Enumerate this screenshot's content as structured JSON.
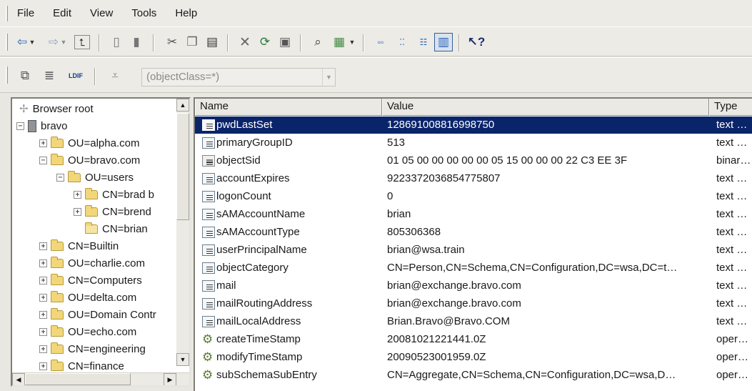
{
  "menu": [
    "File",
    "Edit",
    "View",
    "Tools",
    "Help"
  ],
  "toolbar1": {
    "icons": [
      "back-arrow-icon",
      "back-dropdown-icon",
      "forward-arrow-icon",
      "forward-dropdown-icon",
      "up-level-icon",
      "connect-icon",
      "disconnect-icon",
      "cut-icon",
      "copy-icon",
      "paste-icon",
      "delete-icon",
      "refresh-icon",
      "properties-icon",
      "find-icon",
      "view-dropdown-icon",
      "large-icons-icon",
      "small-icons-icon",
      "list-view-icon",
      "details-view-icon",
      "help-icon"
    ]
  },
  "toolbar2": {
    "icons": [
      "new-entry-icon",
      "search-icon",
      "ldif-icon",
      "filter-icon"
    ],
    "ldif_label": "LDIF",
    "filter_value": "(objectClass=*)"
  },
  "tree": {
    "items": [
      {
        "label": "Browser root",
        "level": 0,
        "icon": "root"
      },
      {
        "label": "bravo",
        "level": 0,
        "icon": "server",
        "expander": "−"
      },
      {
        "label": "OU=alpha.com",
        "level": 1,
        "icon": "folder",
        "expander": "+"
      },
      {
        "label": "OU=bravo.com",
        "level": 1,
        "icon": "folder",
        "expander": "−"
      },
      {
        "label": "OU=users",
        "level": 2,
        "icon": "folder",
        "expander": "−"
      },
      {
        "label": "CN=brad b",
        "level": 3,
        "icon": "folder",
        "expander": "+"
      },
      {
        "label": "CN=brend",
        "level": 3,
        "icon": "folder",
        "expander": "+"
      },
      {
        "label": "CN=brian",
        "level": 3,
        "icon": "folder-open"
      },
      {
        "label": "CN=Builtin",
        "level": 1,
        "icon": "folder",
        "expander": "+"
      },
      {
        "label": "OU=charlie.com",
        "level": 1,
        "icon": "folder",
        "expander": "+"
      },
      {
        "label": "CN=Computers",
        "level": 1,
        "icon": "folder",
        "expander": "+"
      },
      {
        "label": "OU=delta.com",
        "level": 1,
        "icon": "folder",
        "expander": "+"
      },
      {
        "label": "OU=Domain Contr",
        "level": 1,
        "icon": "folder",
        "expander": "+"
      },
      {
        "label": "OU=echo.com",
        "level": 1,
        "icon": "folder",
        "expander": "+"
      },
      {
        "label": "CN=engineering",
        "level": 1,
        "icon": "folder",
        "expander": "+"
      },
      {
        "label": "CN=finance",
        "level": 1,
        "icon": "folder",
        "expander": "+"
      }
    ]
  },
  "list": {
    "columns": [
      "Name",
      "Value",
      "Type"
    ],
    "rows": [
      {
        "name": "pwdLastSet",
        "value": "128691008816998750",
        "type": "text …",
        "icon": "text",
        "selected": true
      },
      {
        "name": "primaryGroupID",
        "value": "513",
        "type": "text …",
        "icon": "text"
      },
      {
        "name": "objectSid",
        "value": "01 05 00 00 00 00 00 05 15 00 00 00 22 C3 EE 3F",
        "type": "binar…",
        "icon": "binary"
      },
      {
        "name": "accountExpires",
        "value": "9223372036854775807",
        "type": "text …",
        "icon": "text"
      },
      {
        "name": "logonCount",
        "value": "0",
        "type": "text …",
        "icon": "text"
      },
      {
        "name": "sAMAccountName",
        "value": "brian",
        "type": "text …",
        "icon": "text"
      },
      {
        "name": "sAMAccountType",
        "value": "805306368",
        "type": "text …",
        "icon": "text"
      },
      {
        "name": "userPrincipalName",
        "value": "brian@wsa.train",
        "type": "text …",
        "icon": "text"
      },
      {
        "name": "objectCategory",
        "value": "CN=Person,CN=Schema,CN=Configuration,DC=wsa,DC=t…",
        "type": "text …",
        "icon": "text"
      },
      {
        "name": "mail",
        "value": "brian@exchange.bravo.com",
        "type": "text …",
        "icon": "text"
      },
      {
        "name": "mailRoutingAddress",
        "value": "brian@exchange.bravo.com",
        "type": "text …",
        "icon": "text"
      },
      {
        "name": "mailLocalAddress",
        "value": "Brian.Bravo@Bravo.COM",
        "type": "text …",
        "icon": "text"
      },
      {
        "name": "createTimeStamp",
        "value": "20081021221441.0Z",
        "type": "oper…",
        "icon": "operational"
      },
      {
        "name": "modifyTimeStamp",
        "value": "20090523001959.0Z",
        "type": "oper…",
        "icon": "operational"
      },
      {
        "name": "subSchemaSubEntry",
        "value": "CN=Aggregate,CN=Schema,CN=Configuration,DC=wsa,D…",
        "type": "oper…",
        "icon": "operational"
      }
    ]
  }
}
